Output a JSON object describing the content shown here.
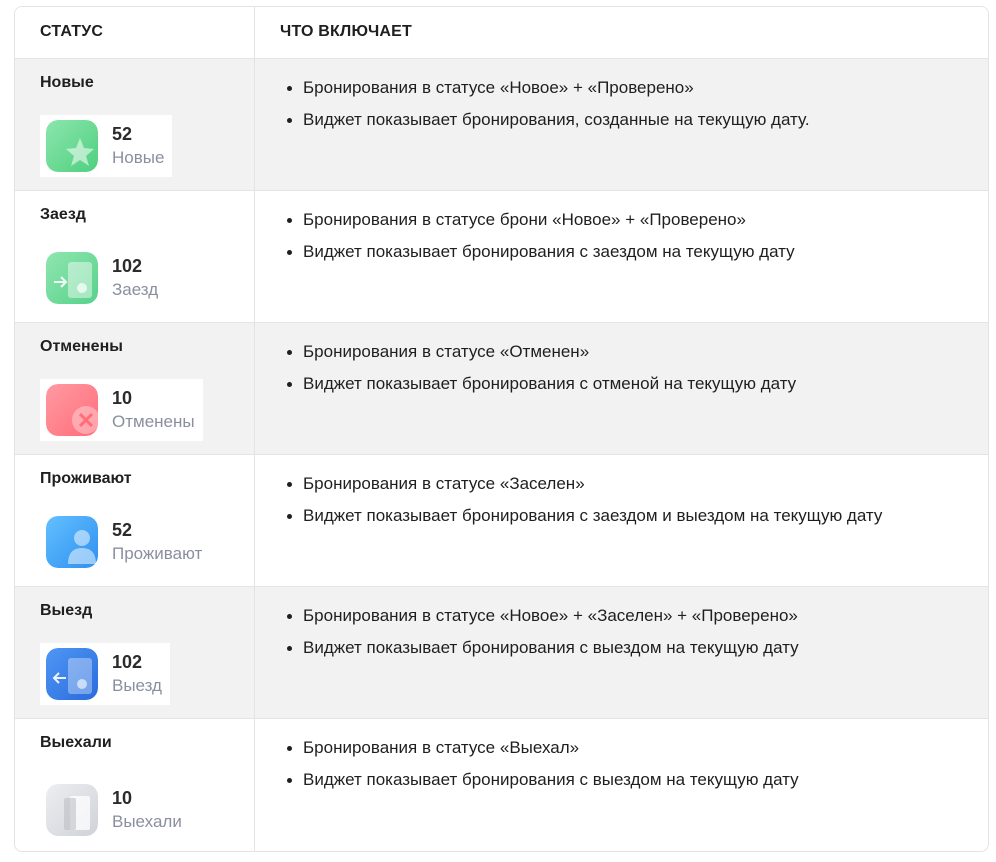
{
  "table": {
    "headers": {
      "status": "СТАТУС",
      "includes": "ЧТО ВКЛЮЧАЕТ"
    },
    "rows": [
      {
        "title": "Новые",
        "count": "52",
        "label": "Новые",
        "icon": "star-icon",
        "color": "#5fd58a",
        "bullets": [
          "Бронирования в статусе «Новое» + «Проверено»",
          "Виджет показывает бронирования, созданные на текущую дату."
        ]
      },
      {
        "title": "Заезд",
        "count": "102",
        "label": "Заезд",
        "icon": "check-in-building-icon",
        "color": "#6ad98f",
        "bullets": [
          "Бронирования в статусе брони «Новое» + «Проверено»",
          "Виджет показывает бронирования с заездом на текущую дату"
        ]
      },
      {
        "title": "Отменены",
        "count": "10",
        "label": "Отменены",
        "icon": "cancel-icon",
        "color": "#ff7b86",
        "bullets": [
          "Бронирования в статусе «Отменен»",
          "Виджет показывает бронирования с отменой на текущую дату"
        ]
      },
      {
        "title": "Проживают",
        "count": "52",
        "label": "Проживают",
        "icon": "person-icon",
        "color": "#3aa3f5",
        "bullets": [
          "Бронирования в статусе «Заселен»",
          "Виджет показывает бронирования с заездом и выездом на текущую дату"
        ]
      },
      {
        "title": "Выезд",
        "count": "102",
        "label": "Выезд",
        "icon": "check-out-building-icon",
        "color": "#3a7ee6",
        "bullets": [
          "Бронирования в статусе «Новое» + «Заселен» + «Проверено»",
          "Виджет показывает бронирования с выездом на текущую дату"
        ]
      },
      {
        "title": "Выехали",
        "count": "10",
        "label": "Выехали",
        "icon": "door-icon",
        "color": "#d5d7dc",
        "bullets": [
          "Бронирования в статусе «Выехал»",
          "Виджет показывает бронирования с выездом на текущую дату"
        ]
      }
    ]
  }
}
